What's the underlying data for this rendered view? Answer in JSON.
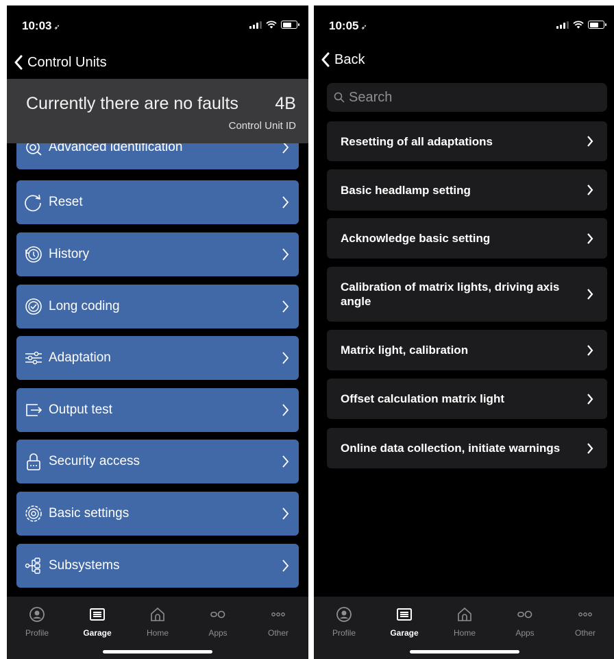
{
  "left": {
    "status": {
      "time": "10:03",
      "location_glyph": "➶"
    },
    "nav": {
      "back_label": "Control Units"
    },
    "banner": {
      "message": "Currently there are no faults",
      "unit_id": "4B",
      "unit_id_label": "Control Unit ID"
    },
    "menu": [
      {
        "label": "Advanced identification",
        "icon": "scan-icon"
      },
      {
        "label": "Reset",
        "icon": "reset-icon"
      },
      {
        "label": "History",
        "icon": "history-icon"
      },
      {
        "label": "Long coding",
        "icon": "check-circle-icon"
      },
      {
        "label": "Adaptation",
        "icon": "sliders-icon"
      },
      {
        "label": "Output test",
        "icon": "output-icon"
      },
      {
        "label": "Security access",
        "icon": "lock-icon"
      },
      {
        "label": "Basic settings",
        "icon": "gear-icon"
      },
      {
        "label": "Subsystems",
        "icon": "tree-icon"
      }
    ],
    "menu_color": "#4169a8"
  },
  "right": {
    "status": {
      "time": "10:05",
      "location_glyph": "➶"
    },
    "nav": {
      "back_label": "Back"
    },
    "search": {
      "placeholder": "Search"
    },
    "functions": [
      {
        "label": "Resetting of all adaptations"
      },
      {
        "label": "Basic headlamp setting"
      },
      {
        "label": "Acknowledge basic setting"
      },
      {
        "label": "Calibration of matrix lights, driving axis angle"
      },
      {
        "label": "Matrix light, calibration"
      },
      {
        "label": "Offset calculation matrix light"
      },
      {
        "label": "Online data collection, initiate warnings"
      }
    ]
  },
  "tabbar": {
    "tabs": [
      {
        "label": "Profile",
        "icon": "profile-icon"
      },
      {
        "label": "Garage",
        "icon": "garage-icon",
        "active": true
      },
      {
        "label": "Home",
        "icon": "home-icon"
      },
      {
        "label": "Apps",
        "icon": "apps-icon"
      },
      {
        "label": "Other",
        "icon": "more-icon"
      }
    ]
  }
}
